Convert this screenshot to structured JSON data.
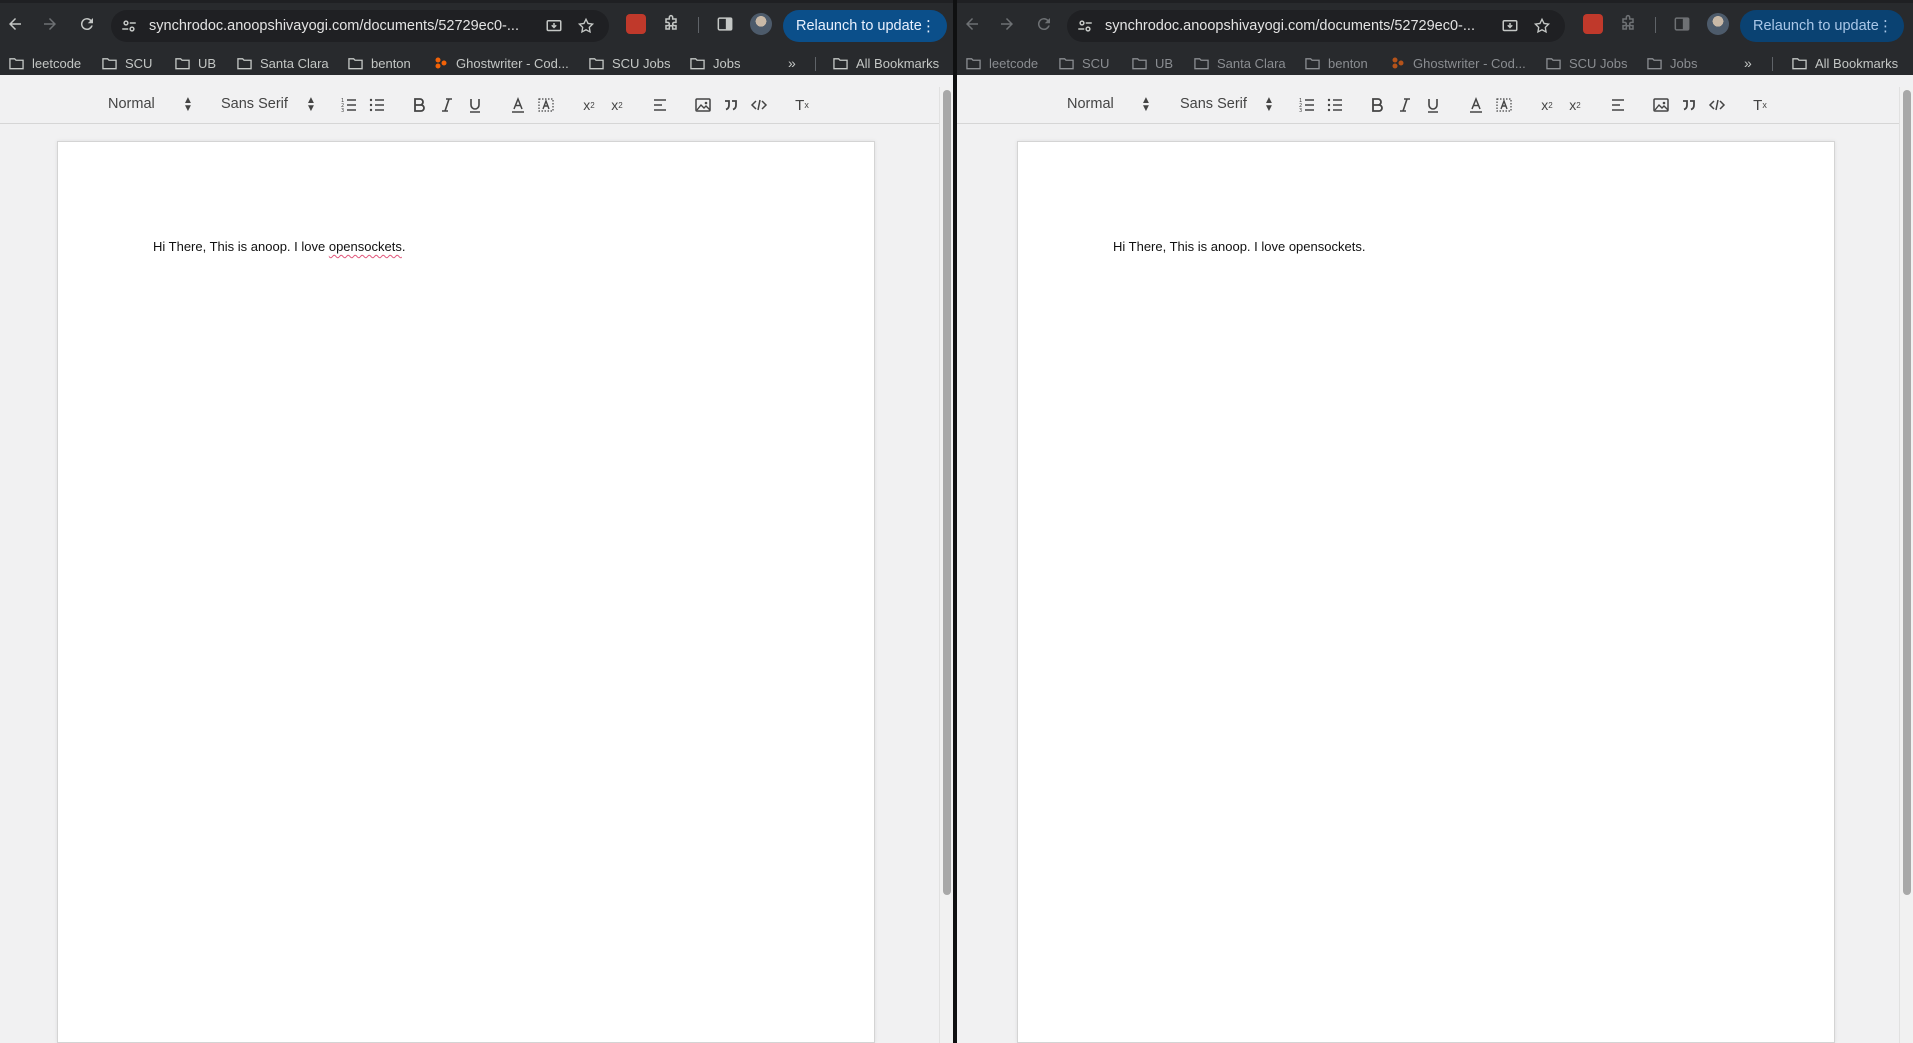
{
  "browser": {
    "url": "synchrodoc.anoopshivayogi.com/documents/52729ec0-...",
    "relaunch_label": "Relaunch to update",
    "kebab": "⋮",
    "bookmarks": [
      "leetcode",
      "SCU",
      "UB",
      "Santa Clara",
      "benton",
      "Ghostwriter - Cod...",
      "SCU Jobs",
      "Jobs"
    ],
    "more": "»",
    "all_bookmarks": "All Bookmarks",
    "accent": "#0b4f8a"
  },
  "editor": {
    "format": "Normal",
    "font": "Sans Serif",
    "subscript_label": "x",
    "superscript_label": "x",
    "clear_label": "T"
  },
  "windows": [
    {
      "text_before": "Hi There, This is anoop. I love ",
      "misspelled": "opensockets",
      "text_after": "."
    },
    {
      "text": "Hi There, This is anoop. I love opensockets."
    }
  ]
}
